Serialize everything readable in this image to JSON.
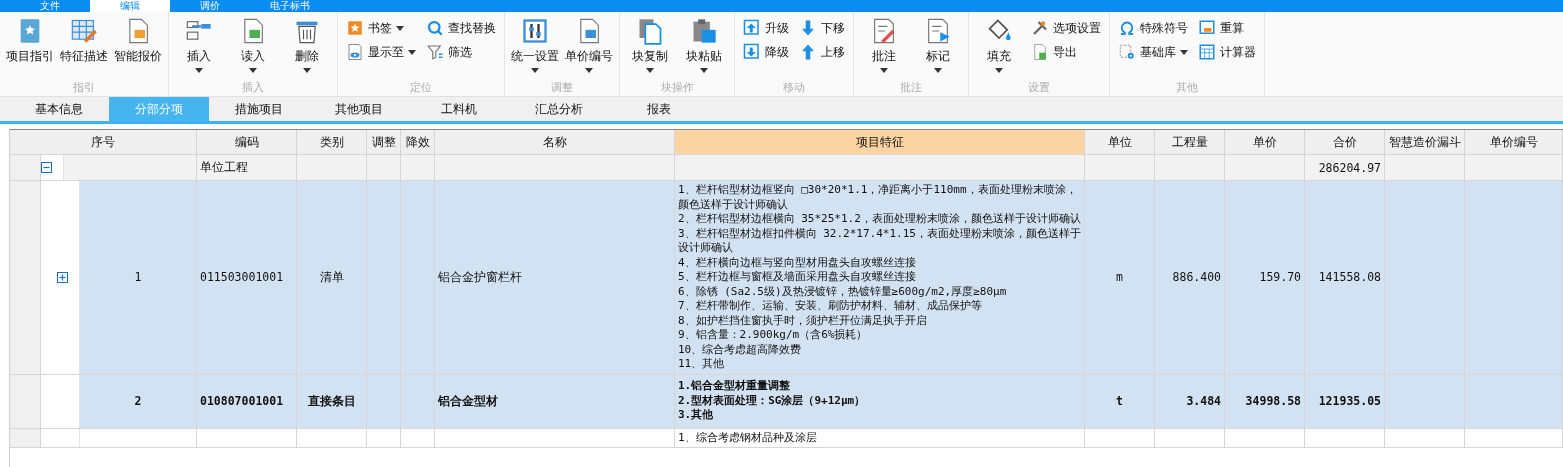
{
  "menu_tabs": [
    {
      "label": "文件",
      "selected": false
    },
    {
      "label": "编辑",
      "selected": true
    },
    {
      "label": "调价",
      "selected": false
    },
    {
      "label": "电子标书",
      "selected": false
    }
  ],
  "ribbon_groups": [
    {
      "title": "指引",
      "items": [
        {
          "label": "项目指引",
          "kind": "large",
          "dropdown": false
        },
        {
          "label": "特征描述",
          "kind": "large",
          "dropdown": false
        },
        {
          "label": "智能报价",
          "kind": "large",
          "dropdown": false
        }
      ]
    },
    {
      "title": "插入",
      "items": [
        {
          "label": "插入",
          "kind": "large",
          "dropdown": true
        },
        {
          "label": "读入",
          "kind": "large",
          "dropdown": true
        },
        {
          "label": "删除",
          "kind": "large",
          "dropdown": true
        }
      ]
    },
    {
      "title": "定位",
      "items": [
        {
          "label": "书签",
          "kind": "small",
          "dropdown": true
        },
        {
          "label": "显示至",
          "kind": "small",
          "dropdown": true
        },
        {
          "label": "查找替换",
          "kind": "small",
          "dropdown": false
        },
        {
          "label": "筛选",
          "kind": "small",
          "dropdown": false
        }
      ]
    },
    {
      "title": "调整",
      "items": [
        {
          "label": "统一设置",
          "kind": "large",
          "dropdown": true
        },
        {
          "label": "单价编号",
          "kind": "large",
          "dropdown": true
        }
      ]
    },
    {
      "title": "块操作",
      "items": [
        {
          "label": "块复制",
          "kind": "large",
          "dropdown": true
        },
        {
          "label": "块粘贴",
          "kind": "large",
          "dropdown": true
        }
      ]
    },
    {
      "title": "移动",
      "items": [
        {
          "label": "升级",
          "kind": "small",
          "dropdown": false
        },
        {
          "label": "降级",
          "kind": "small",
          "dropdown": false
        },
        {
          "label": "下移",
          "kind": "small",
          "dropdown": false
        },
        {
          "label": "上移",
          "kind": "small",
          "dropdown": false
        }
      ]
    },
    {
      "title": "批注",
      "items": [
        {
          "label": "批注",
          "kind": "large",
          "dropdown": true
        },
        {
          "label": "标记",
          "kind": "large",
          "dropdown": true
        }
      ]
    },
    {
      "title": "设置",
      "items": [
        {
          "label": "填充",
          "kind": "large",
          "dropdown": true
        },
        {
          "label": "选项设置",
          "kind": "small",
          "dropdown": false
        },
        {
          "label": "导出",
          "kind": "small",
          "dropdown": false
        }
      ]
    },
    {
      "title": "其他",
      "items": [
        {
          "label": "特殊符号",
          "kind": "small",
          "dropdown": false
        },
        {
          "label": "基础库",
          "kind": "small",
          "dropdown": true
        },
        {
          "label": "重算",
          "kind": "small",
          "dropdown": false
        },
        {
          "label": "计算器",
          "kind": "small",
          "dropdown": false
        }
      ]
    }
  ],
  "view_tabs": [
    {
      "label": "基本信息",
      "selected": false
    },
    {
      "label": "分部分项",
      "selected": true
    },
    {
      "label": "措施项目",
      "selected": false
    },
    {
      "label": "其他项目",
      "selected": false
    },
    {
      "label": "工料机",
      "selected": false
    },
    {
      "label": "汇总分析",
      "selected": false
    },
    {
      "label": "报表",
      "selected": false
    }
  ],
  "table": {
    "columns": [
      {
        "label": "序号",
        "highlighted": false
      },
      {
        "label": "编码",
        "highlighted": false
      },
      {
        "label": "类别",
        "highlighted": false
      },
      {
        "label": "调整",
        "highlighted": false
      },
      {
        "label": "降效",
        "highlighted": false
      },
      {
        "label": "名称",
        "highlighted": false
      },
      {
        "label": "项目特征",
        "highlighted": true
      },
      {
        "label": "单位",
        "highlighted": false
      },
      {
        "label": "工程量",
        "highlighted": false
      },
      {
        "label": "单价",
        "highlighted": false
      },
      {
        "label": "合价",
        "highlighted": false
      },
      {
        "label": "智慧造价漏斗",
        "highlighted": false
      },
      {
        "label": "单价编号",
        "highlighted": false
      }
    ],
    "rows": [
      {
        "kind": "unit",
        "code": "单位工程",
        "total": "286204.97",
        "expanded": true,
        "children": [
          {
            "kind": "bill",
            "selected": true,
            "expanded": false,
            "seq": "1",
            "code": "011503001001",
            "category": "清单",
            "name": "铝合金护窗栏杆",
            "features": [
              "1、栏杆铝型材边框竖向  □30*20*1.1，净距离小于110mm，表面处理粉末喷涂，颜色送样于设计师确认",
              "2、栏杆铝型材边框横向  35*25*1.2，表面处理粉末喷涂，颜色送样于设计师确认",
              "3、栏杆铝型材边框扣件横向  32.2*17.4*1.15，表面处理粉末喷涂，颜色送样于设计师确认",
              "4、栏杆横向边框与竖向型材用盘头自攻螺丝连接",
              "5、栏杆边框与窗框及墙面采用盘头自攻螺丝连接",
              "6、除锈 (Sa2.5级)及热浸镀锌，热镀锌量≥600g/m2,厚度≥80μm",
              "7、栏杆带制作、运输、安装、刷防护材料、辅材、成品保护等",
              "8、如护栏挡住窗执手时，须护栏开位满足执手开启",
              "9、铝含量：2.900kg/m（含6%损耗）",
              "10、综合考虑超高降效费",
              "11、其他"
            ],
            "unit": "m",
            "quantity": "886.400",
            "price": "159.70",
            "total": "141558.08"
          },
          {
            "kind": "direct",
            "selected": true,
            "seq": "2",
            "code": "010807001001",
            "category": "直接条目",
            "name": "铝合金型材",
            "features": [
              "1.铝合金型材重量调整",
              "2.型材表面处理：SG涂层（9+12μm）",
              "3.其他"
            ],
            "unit": "t",
            "quantity": "3.484",
            "price": "34998.58",
            "total": "121935.05"
          },
          {
            "kind": "bill",
            "selected": false,
            "features": [
              "1、综合考虑钢材品种及涂层"
            ]
          }
        ]
      }
    ]
  }
}
